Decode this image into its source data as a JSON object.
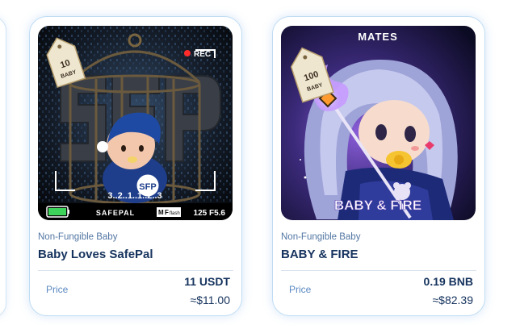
{
  "cards": [
    {
      "category": "Non-Fungible Baby",
      "name": "Baby Loves SafePal",
      "price_label": "Price",
      "price": "11 USDT",
      "price_fiat": "≈$11.00",
      "image": {
        "tag_number": "10",
        "tag_word": "BABY",
        "rec_label": "REC",
        "countdown": "3..2..1..1..2..3",
        "brand": "SAFEPAL",
        "mode_label": "M",
        "mode_tag": "F",
        "mode_word": "flash",
        "camera_settings": "125 F5.6",
        "badge_text": "SFP"
      }
    },
    {
      "category": "Non-Fungible Baby",
      "name": "BABY & FIRE",
      "price_label": "Price",
      "price": "0.19 BNB",
      "price_fiat": "≈$82.39",
      "image": {
        "header": "MATES",
        "tag_number": "100",
        "tag_word": "BABY",
        "caption": "BABY & FIRE"
      }
    }
  ],
  "colors": {
    "accent_border": "#bfdcf4",
    "title": "#16335e",
    "category": "#5276a3",
    "price_label": "#5c89c2",
    "rec_red": "#ff2b2b",
    "battery_green": "#3ed35a"
  }
}
